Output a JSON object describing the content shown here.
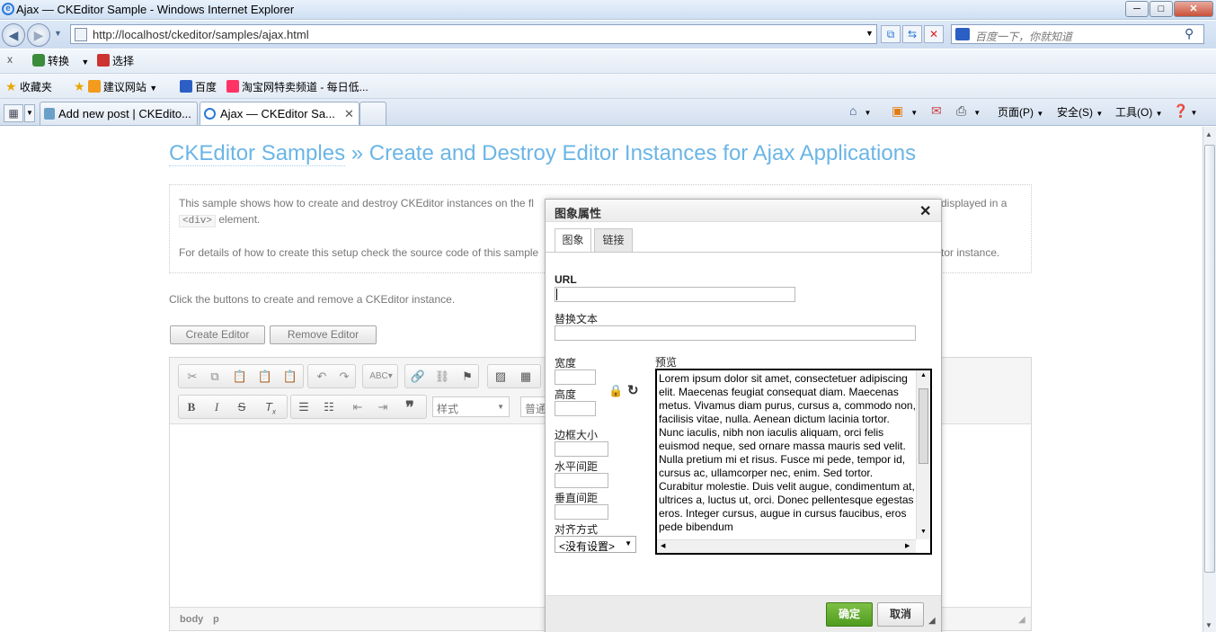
{
  "window": {
    "title": "Ajax — CKEditor Sample - Windows Internet Explorer",
    "min": "─",
    "max": "□",
    "close": "✕"
  },
  "address": {
    "url": "http://localhost/ckeditor/samples/ajax.html",
    "search_placeholder": "百度一下，你就知道"
  },
  "toolbar1": {
    "close": "x",
    "convert": "转换",
    "select": "选择"
  },
  "favorites": {
    "favorites": "收藏夹",
    "suggested": "建议网站",
    "baidu": "百度",
    "taobao": "淘宝网特卖频道 - 每日低..."
  },
  "tabs": [
    {
      "label": "Add new post | CKEdito..."
    },
    {
      "label": "Ajax — CKEditor Sa..."
    }
  ],
  "commandbar": {
    "page": "页面(P)",
    "safety": "安全(S)",
    "tools": "工具(O)"
  },
  "page": {
    "title_crumb": "CKEditor Samples",
    "title_sep": " » ",
    "title_rest": "Create and Destroy Editor Instances for Ajax Applications",
    "desc1a": "This sample shows how to create and destroy CKEditor instances on the fl",
    "desc1b": "displayed in a",
    "desc_code": "<div>",
    "desc2": " element.",
    "desc3a": "For details of how to create this setup check the source code of this sample",
    "desc3b": "tor instance.",
    "info": "Click the buttons to create and remove a CKEditor instance.",
    "create_btn": "Create Editor",
    "remove_btn": "Remove Editor"
  },
  "editor": {
    "style_combo": "样式",
    "format_combo": "普通",
    "path": [
      "body",
      "p"
    ]
  },
  "dialog": {
    "title": "图象属性",
    "close": "✕",
    "tab_image": "图象",
    "tab_link": "链接",
    "url_label": "URL",
    "url_value": "",
    "alt_label": "替换文本",
    "width_label": "宽度",
    "height_label": "高度",
    "border_label": "边框大小",
    "hspace_label": "水平间距",
    "vspace_label": "垂直间距",
    "align_label": "对齐方式",
    "align_value": "<没有设置>",
    "preview_label": "预览",
    "preview_text": "Lorem ipsum dolor sit amet, consectetuer adipiscing elit. Maecenas feugiat consequat diam. Maecenas metus. Vivamus diam purus, cursus a, commodo non, facilisis vitae, nulla. Aenean dictum lacinia tortor. Nunc iaculis, nibh non iaculis aliquam, orci felis euismod neque, sed ornare massa mauris sed velit. Nulla pretium mi et risus. Fusce mi pede, tempor id, cursus ac, ullamcorper nec, enim. Sed tortor. Curabitur molestie. Duis velit augue, condimentum at, ultrices a, luctus ut, orci. Donec pellentesque egestas eros. Integer cursus, augue in cursus faucibus, eros pede bibendum",
    "ok": "确定",
    "cancel": "取消"
  },
  "colors": {
    "accent": "#6bb5e6",
    "ok_green": "#5aa82a"
  }
}
